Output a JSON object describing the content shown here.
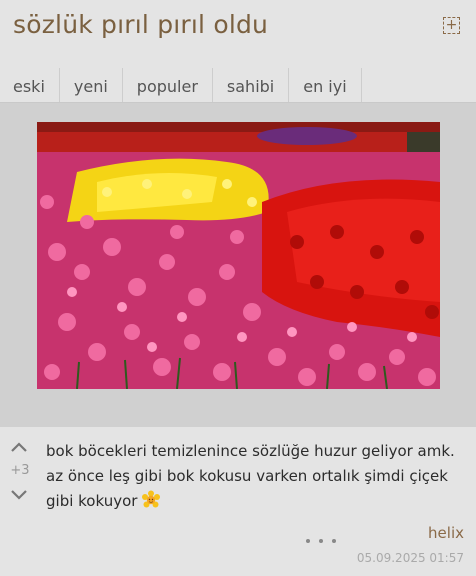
{
  "header": {
    "title": "sözlük pırıl pırıl oldu",
    "add_icon": "plus-square-icon"
  },
  "tabs": [
    {
      "label": "eski"
    },
    {
      "label": "yeni"
    },
    {
      "label": "populer"
    },
    {
      "label": "sahibi"
    },
    {
      "label": "en iyi"
    }
  ],
  "entry": {
    "score": "+3",
    "text": "bok böcekleri temizlenince sözlüğe huzur geliyor amk. az önce leş gibi bok kokusu varken ortalık şimdi çiçek gibi kokuyor",
    "emoji": "sunflower-emoji",
    "author": "helix",
    "timestamp": "05.09.2025 01:57"
  },
  "colors": {
    "accent": "#7a6040",
    "background": "#e4e4e4"
  }
}
